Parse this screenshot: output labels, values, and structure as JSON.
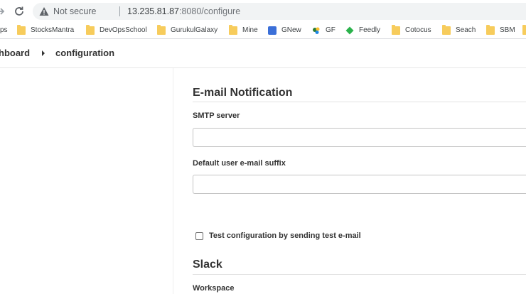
{
  "browser": {
    "security_label": "Not secure",
    "url_host": "13.235.81.87",
    "url_rest": ":8080/configure"
  },
  "bookmarks": [
    {
      "label": "ps",
      "icon": "apps-icon"
    },
    {
      "label": "StocksMantra",
      "icon": "folder-icon"
    },
    {
      "label": "DevOpsSchool",
      "icon": "folder-icon"
    },
    {
      "label": "GurukulGalaxy",
      "icon": "folder-icon"
    },
    {
      "label": "Mine",
      "icon": "folder-icon"
    },
    {
      "label": "GNew",
      "icon": "gnew-icon"
    },
    {
      "label": "GF",
      "icon": "gf-icon"
    },
    {
      "label": "Feedly",
      "icon": "feedly-icon"
    },
    {
      "label": "Cotocus",
      "icon": "folder-icon"
    },
    {
      "label": "Seach",
      "icon": "folder-icon"
    },
    {
      "label": "SBM",
      "icon": "folder-icon"
    }
  ],
  "breadcrumb": {
    "dashboard": "hboard",
    "current": "configuration"
  },
  "email_notification": {
    "title": "E-mail Notification",
    "smtp_label": "SMTP server",
    "smtp_value": "",
    "suffix_label": "Default user e-mail suffix",
    "suffix_value": "",
    "test_checkbox_label": "Test configuration by sending test e-mail",
    "test_checked": false
  },
  "slack": {
    "title": "Slack",
    "workspace_label": "Workspace"
  }
}
